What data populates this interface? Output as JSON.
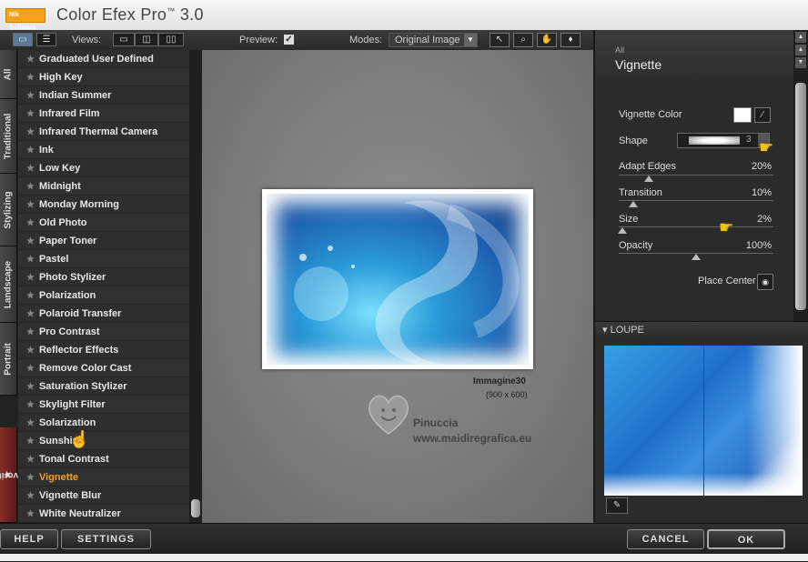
{
  "app": {
    "logo_text": "Nik Software",
    "title": "Color Efex Pro",
    "title_tm": "™",
    "version": "3.0"
  },
  "toolbar": {
    "views_label": "Views:",
    "preview_label": "Preview:",
    "preview_checked": "✓",
    "modes_label": "Modes:",
    "modes_value": "Original Image"
  },
  "category_tabs": [
    "All",
    "Traditional",
    "Stylizing",
    "Landscape",
    "Portrait",
    "Favorites"
  ],
  "filters": [
    "Graduated User Defined",
    "High Key",
    "Indian Summer",
    "Infrared Film",
    "Infrared Thermal Camera",
    "Ink",
    "Low Key",
    "Midnight",
    "Monday Morning",
    "Old Photo",
    "Paper Toner",
    "Pastel",
    "Photo Stylizer",
    "Polarization",
    "Polaroid Transfer",
    "Pro Contrast",
    "Reflector Effects",
    "Remove Color Cast",
    "Saturation Stylizer",
    "Skylight Filter",
    "Solarization",
    "Sunshine",
    "Tonal Contrast",
    "Vignette",
    "Vignette Blur",
    "White Neutralizer"
  ],
  "active_filter": "Vignette",
  "preview": {
    "image_name": "Immagine30",
    "image_dims": "(900 x 600)",
    "watermark_name": "Pinuccia",
    "watermark_site": "www.maidiregrafica.eu"
  },
  "panel": {
    "category": "All",
    "filter_name": "Vignette",
    "vignette_color_label": "Vignette Color",
    "vignette_color": "#ffffff",
    "shape_label": "Shape",
    "shape_value": "3",
    "adapt_edges_label": "Adapt Edges",
    "adapt_edges_value": "20%",
    "transition_label": "Transition",
    "transition_value": "10%",
    "size_label": "Size",
    "size_value": "2%",
    "opacity_label": "Opacity",
    "opacity_value": "100%",
    "place_center_label": "Place Center",
    "loupe_label": "LOUPE"
  },
  "buttons": {
    "help": "HELP",
    "settings": "SETTINGS",
    "cancel": "CANCEL",
    "ok": "OK"
  },
  "colors": {
    "accent": "#f6a21c",
    "panel_bg": "#2b2b2b"
  }
}
